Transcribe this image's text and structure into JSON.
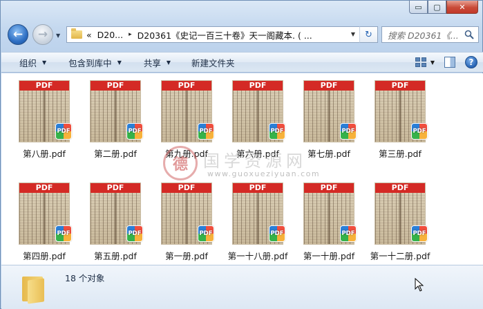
{
  "window": {
    "minimize_glyph": "▭",
    "maximize_glyph": "▢",
    "close_glyph": "✕"
  },
  "navigation": {
    "back_glyph": "←",
    "forward_glyph": "→",
    "dropdown_glyph": "▼"
  },
  "address": {
    "overflow_chevron": "«",
    "crumb_1": "D20...",
    "separator": "▸",
    "crumb_2": "D20361《史记一百三十卷》天一阁藏本. ( ...",
    "dropdown_glyph": "▼",
    "refresh_glyph": "↻"
  },
  "search": {
    "placeholder": "搜索 D20361《..."
  },
  "toolbar": {
    "organize": "组织",
    "include_in_library": "包含到库中",
    "share": "共享",
    "new_folder": "新建文件夹",
    "dropdown_glyph": "▼",
    "help_glyph": "?"
  },
  "files": [
    {
      "name": "第八册.pdf",
      "banner": "PDF"
    },
    {
      "name": "第二册.pdf",
      "banner": "PDF"
    },
    {
      "name": "第九册.pdf",
      "banner": "PDF"
    },
    {
      "name": "第六册.pdf",
      "banner": "PDF"
    },
    {
      "name": "第七册.pdf",
      "banner": "PDF"
    },
    {
      "name": "第三册.pdf",
      "banner": "PDF"
    },
    {
      "name": "第四册.pdf",
      "banner": "PDF"
    },
    {
      "name": "第五册.pdf",
      "banner": "PDF"
    },
    {
      "name": "第一册.pdf",
      "banner": "PDF"
    },
    {
      "name": "第一十八册.pdf",
      "banner": "PDF"
    },
    {
      "name": "第一十册.pdf",
      "banner": "PDF"
    },
    {
      "name": "第一十二册.pdf",
      "banner": "PDF"
    }
  ],
  "badge_label": "PDF",
  "watermark": {
    "seal_char": "德",
    "title": "国学资源网",
    "url": "www.guoxueziyuan.com"
  },
  "details": {
    "item_count": "18 个对象"
  }
}
